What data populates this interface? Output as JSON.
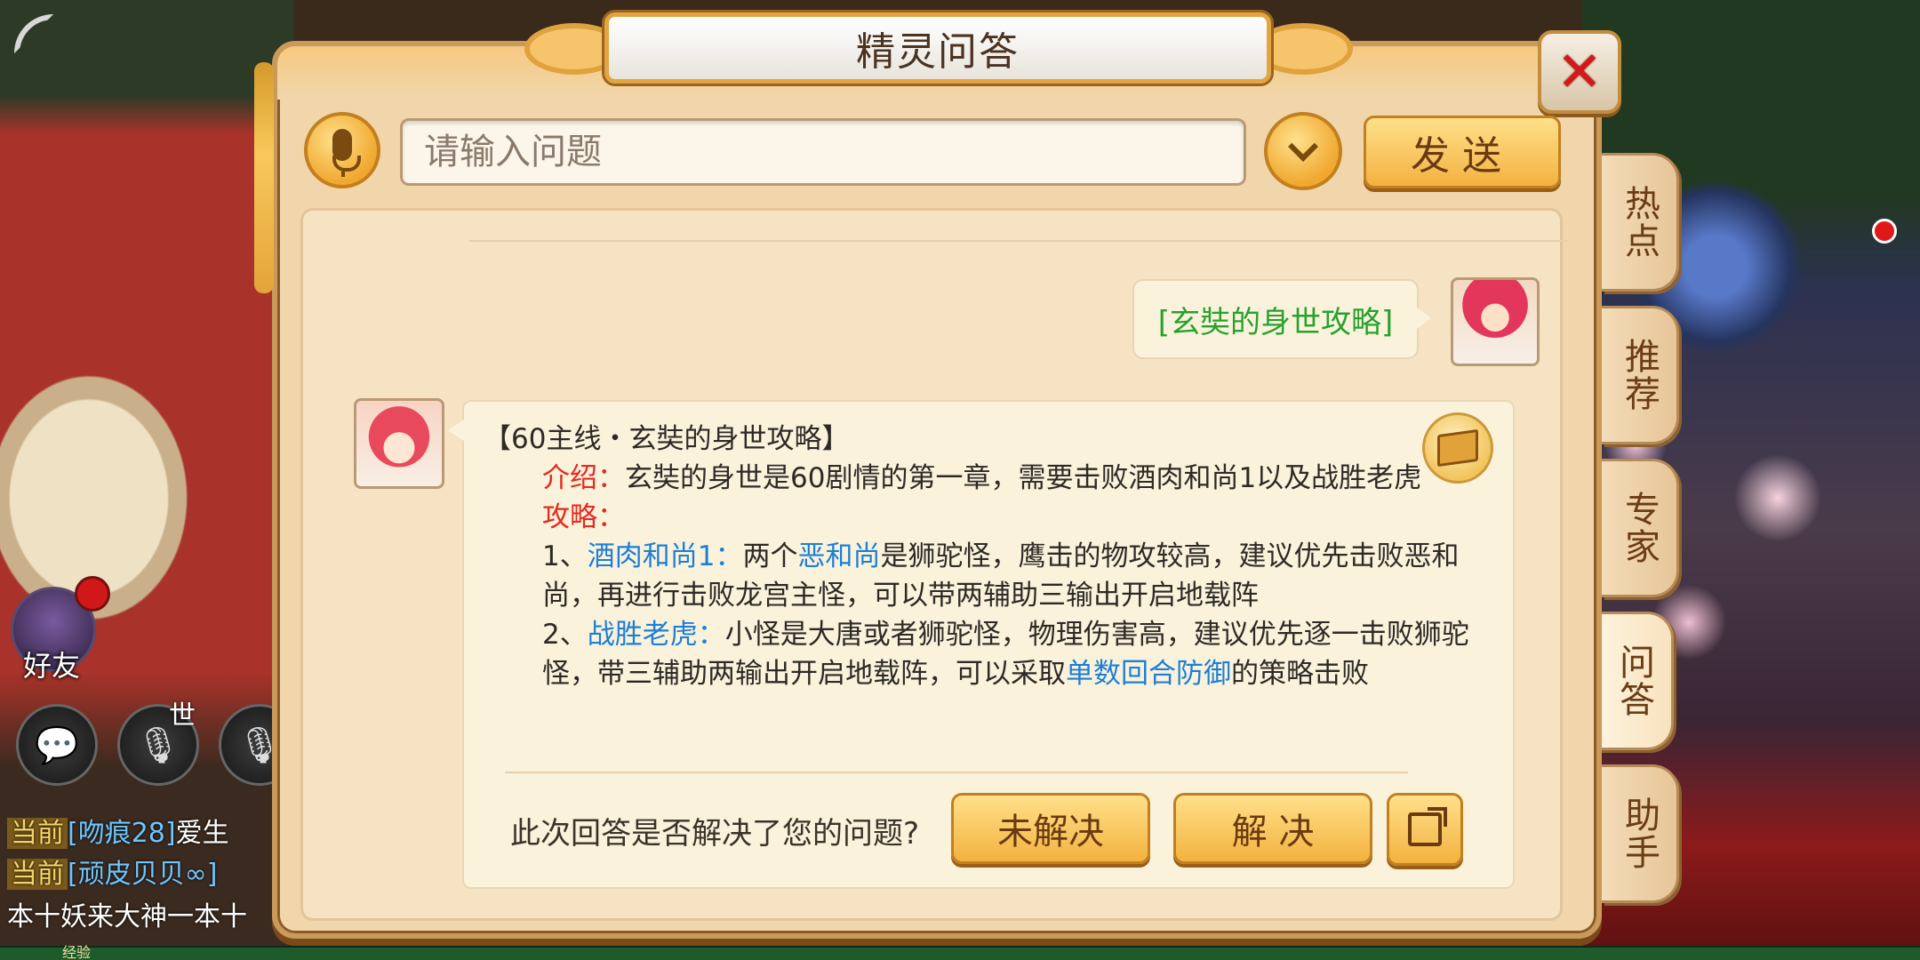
{
  "dialog": {
    "title": "精灵问答",
    "close_label": "✕"
  },
  "input": {
    "placeholder": "请输入问题",
    "value": "",
    "send_label": "发送"
  },
  "side_tabs": [
    {
      "label": "热点"
    },
    {
      "label": "推荐"
    },
    {
      "label": "专家"
    },
    {
      "label": "问答",
      "active": true
    },
    {
      "label": "助手"
    }
  ],
  "user_message": "[玄奘的身世攻略]",
  "answer": {
    "heading": "【60主线・玄奘的身世攻略】",
    "intro_label": "介绍：",
    "intro_text": "玄奘的身世是60剧情的第一章，需要击败酒肉和尚1以及战胜老虎",
    "strategy_label": "攻略：",
    "step1_prefix": "1、",
    "step1_label": "酒肉和尚1：",
    "step1_text_a": "两个",
    "step1_link": "恶和尚",
    "step1_text_b": "是狮驼怪，鹰击的物攻较高，建议优先击败恶和尚，再进行击败龙宫主怪，可以带两辅助三输出开启地载阵",
    "step2_prefix": "2、",
    "step2_label": "战胜老虎：",
    "step2_text_a": "小怪是大唐或者狮驼怪，物理伤害高，建议优先逐一击败狮驼怪，带三辅助两输出开启地载阵，可以采取",
    "step2_link": "单数回合防御",
    "step2_text_b": "的策略击败"
  },
  "feedback": {
    "question": "此次回答是否解决了您的问题?",
    "unresolved_label": "未解决",
    "resolved_label": "解 决"
  },
  "hud": {
    "friend_label": "好友",
    "world_label": "世",
    "exp_label": "经验",
    "chat_lines": [
      {
        "tag": "当前",
        "name": "[吻痕28]",
        "text": "爱生"
      },
      {
        "tag": "当前",
        "name": "[顽皮贝贝∞]",
        "text": ""
      },
      {
        "tag": "",
        "name": "",
        "text": "本十妖来大神一本十"
      }
    ]
  },
  "colors": {
    "accent_gold": "#f3b240",
    "intro_red": "#e42a20",
    "link_blue": "#1d7fd6",
    "user_green": "#27a22d",
    "close_red": "#d21a1a"
  }
}
